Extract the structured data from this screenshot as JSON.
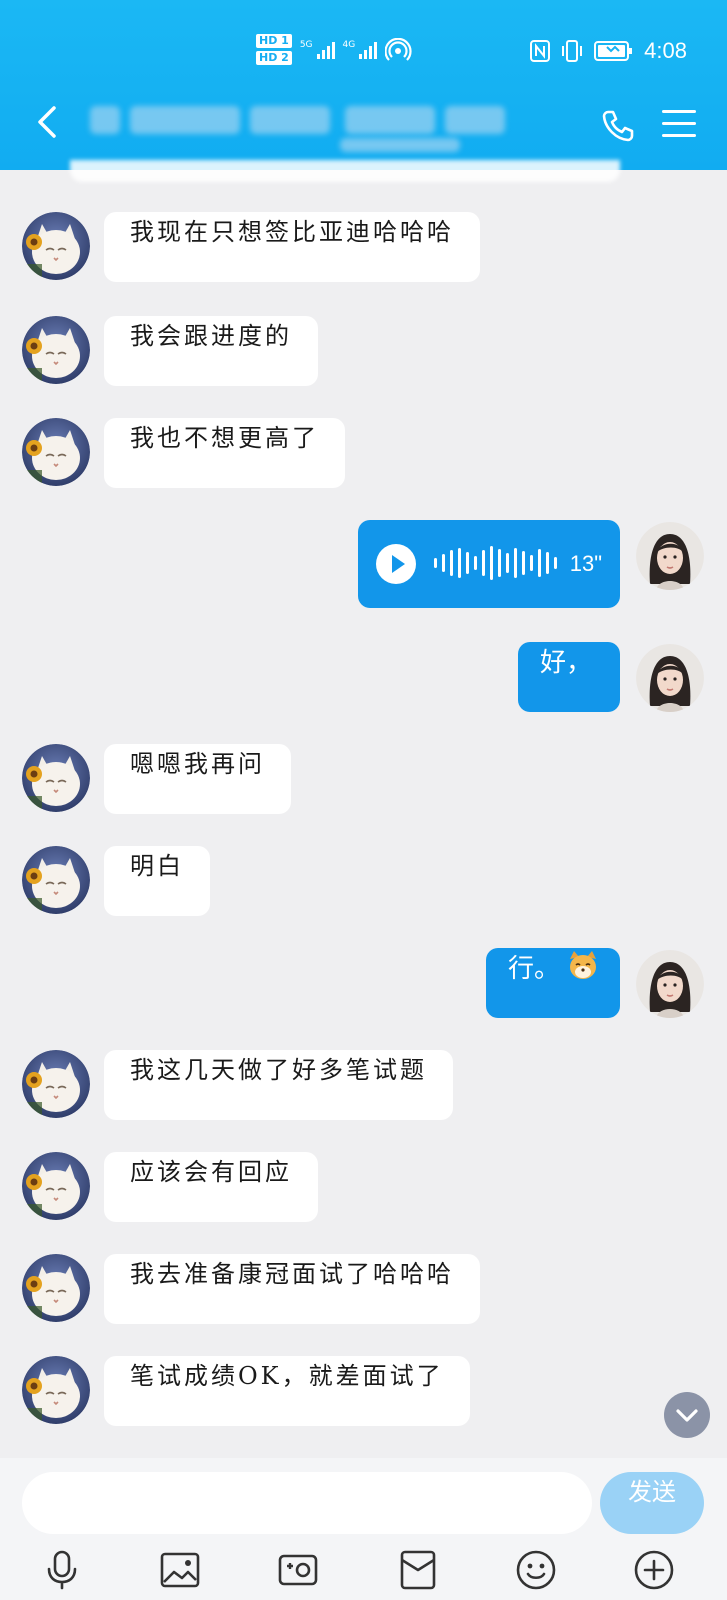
{
  "status_bar": {
    "hd1": "HD 1",
    "hd2": "HD 2",
    "net1": "5G",
    "net2": "4G",
    "time": "4:08",
    "icons": [
      "nfc-icon",
      "vibrate-icon",
      "battery-icon"
    ]
  },
  "header": {
    "title": "",
    "back_icon": "chevron-left-icon",
    "call_icon": "phone-icon",
    "menu_icon": "menu-icon"
  },
  "messages": [
    {
      "side": "left",
      "text": "我现在只想签比亚迪哈哈哈"
    },
    {
      "side": "left",
      "text": "我会跟进度的"
    },
    {
      "side": "left",
      "text": "我也不想更高了"
    },
    {
      "side": "right",
      "type": "voice",
      "duration": "13\""
    },
    {
      "side": "right",
      "text": "好，"
    },
    {
      "side": "left",
      "text": "嗯嗯我再问"
    },
    {
      "side": "left",
      "text": "明白"
    },
    {
      "side": "right",
      "text": "行。",
      "emoji": "dog-emoji"
    },
    {
      "side": "left",
      "text": "我这几天做了好多笔试题"
    },
    {
      "side": "left",
      "text": "应该会有回应"
    },
    {
      "side": "left",
      "text": "我去准备康冠面试了哈哈哈"
    },
    {
      "side": "left",
      "text": "笔试成绩OK，就差面试了"
    }
  ],
  "composer": {
    "input_value": "",
    "send_label": "发送",
    "tools": [
      "microphone-icon",
      "image-icon",
      "camera-icon",
      "red-packet-icon",
      "emoji-icon",
      "plus-icon"
    ]
  },
  "colors": {
    "header": "#15b2f3",
    "bubble_self": "#1296ea",
    "bubble_other": "#ffffff",
    "background": "#efeff1",
    "send_button": "#9ad2f6"
  }
}
